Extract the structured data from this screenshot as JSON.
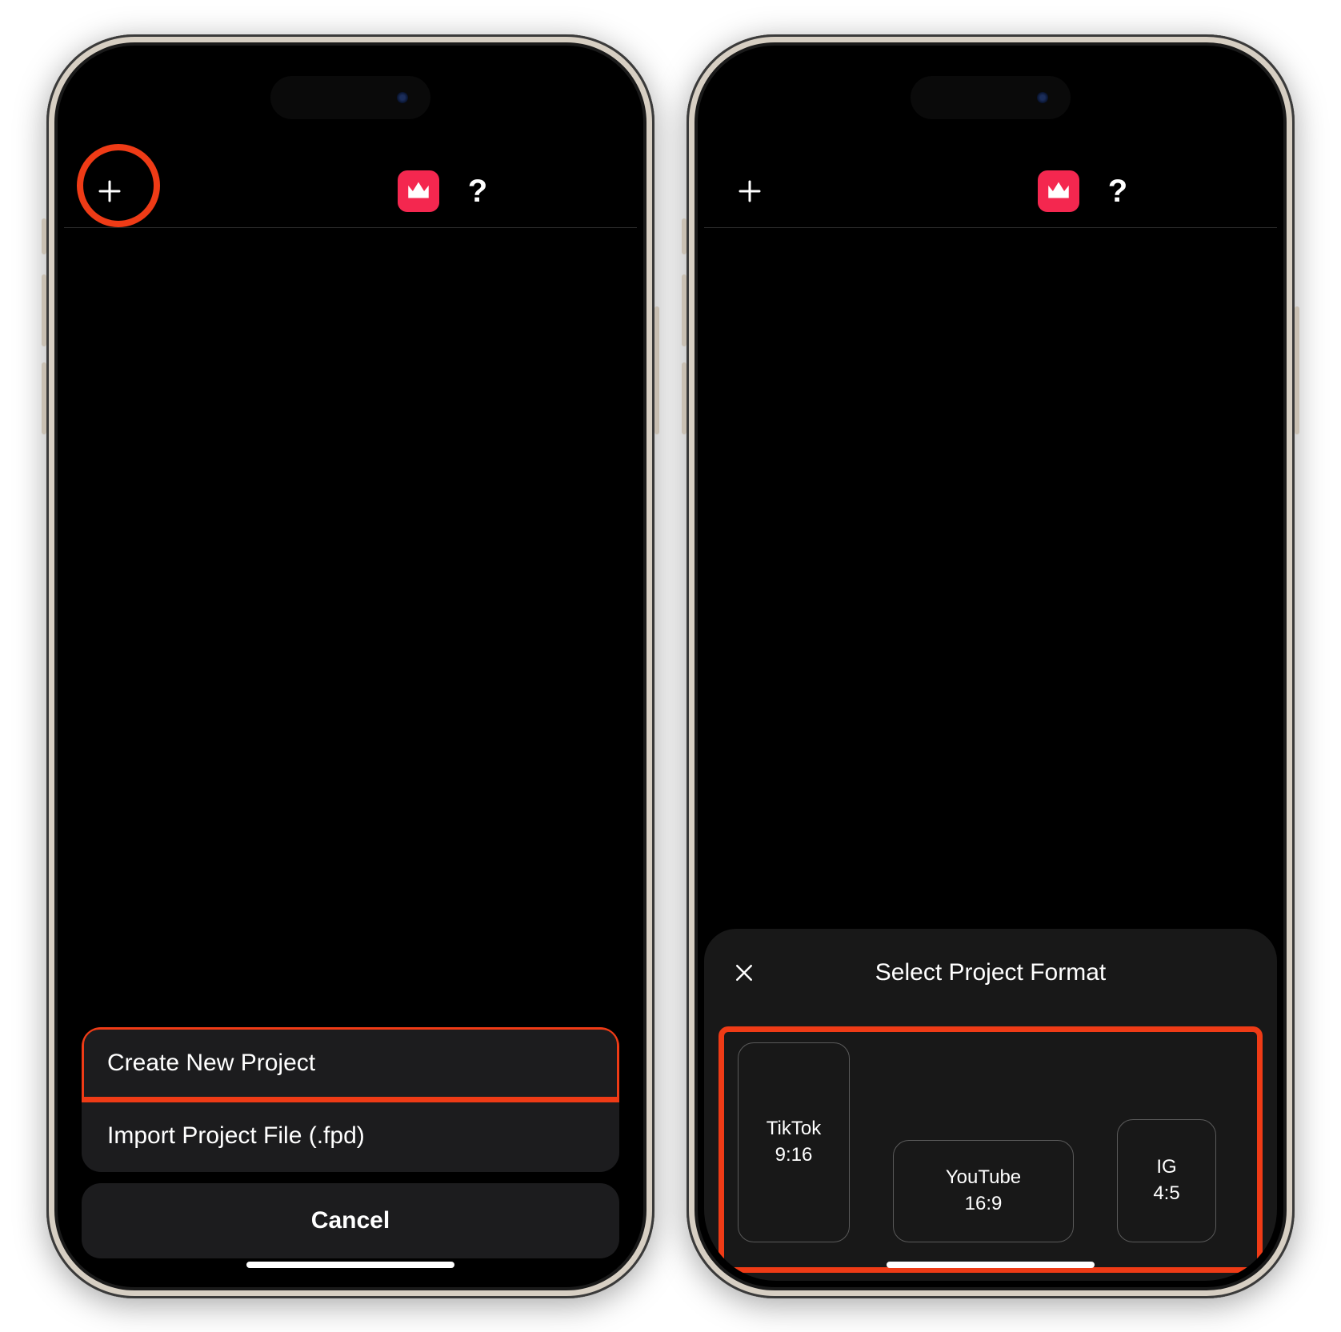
{
  "left": {
    "sheet": {
      "options": [
        {
          "label": "Create New Project"
        },
        {
          "label": "Import Project File (.fpd)"
        }
      ],
      "cancel": "Cancel"
    }
  },
  "right": {
    "formatPanel": {
      "title": "Select Project Format",
      "options": [
        {
          "name": "TikTok",
          "ratio": "9:16"
        },
        {
          "name": "YouTube",
          "ratio": "16:9"
        },
        {
          "name": "IG",
          "ratio": "4:5"
        }
      ]
    }
  },
  "colors": {
    "highlight": "#ef3b16",
    "accent": "#f4274f"
  }
}
